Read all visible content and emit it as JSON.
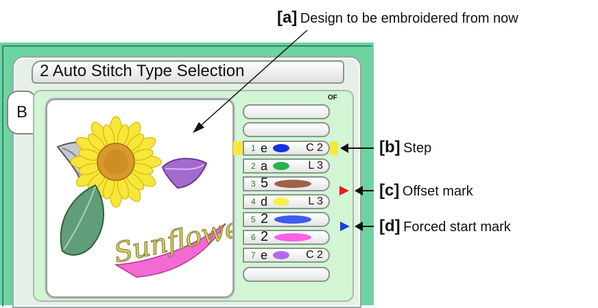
{
  "screen": {
    "title": "2 Auto Stitch Type Selection",
    "tab_label": "B",
    "of_label": "OF"
  },
  "steps": [
    {
      "number": "",
      "kind": "",
      "color": "",
      "code": ""
    },
    {
      "number": "",
      "kind": "",
      "color": "",
      "code": ""
    },
    {
      "number": "1",
      "kind": "e",
      "color": "#1a2fe0",
      "code": "C 2"
    },
    {
      "number": "2",
      "kind": "a",
      "color": "#2bb34a",
      "code": "L 3"
    },
    {
      "number": "3",
      "kind": "5",
      "color": "#a0614a",
      "code": ""
    },
    {
      "number": "4",
      "kind": "d",
      "color": "#f4f04a",
      "code": "L 3"
    },
    {
      "number": "5",
      "kind": "2",
      "color": "#3f5cf0",
      "code": ""
    },
    {
      "number": "6",
      "kind": "2",
      "color": "#ff5fe6",
      "code": ""
    },
    {
      "number": "7",
      "kind": "e",
      "color": "#b368ef",
      "code": "C 2"
    },
    {
      "number": "",
      "kind": "",
      "color": "",
      "code": ""
    }
  ],
  "design": {
    "text": "Sunflower"
  },
  "callouts": {
    "a": {
      "key": "[a]",
      "text": "Design to be embroidered from now"
    },
    "b": {
      "key": "[b]",
      "text": "Step"
    },
    "c": {
      "key": "[c]",
      "text": "Offset mark"
    },
    "d": {
      "key": "[d]",
      "text": "Forced start mark"
    }
  },
  "marks": {
    "current_step_color": "#f6e83b",
    "offset_mark_color": "#e31b1b",
    "forced_start_mark_color": "#1f3bd6"
  }
}
